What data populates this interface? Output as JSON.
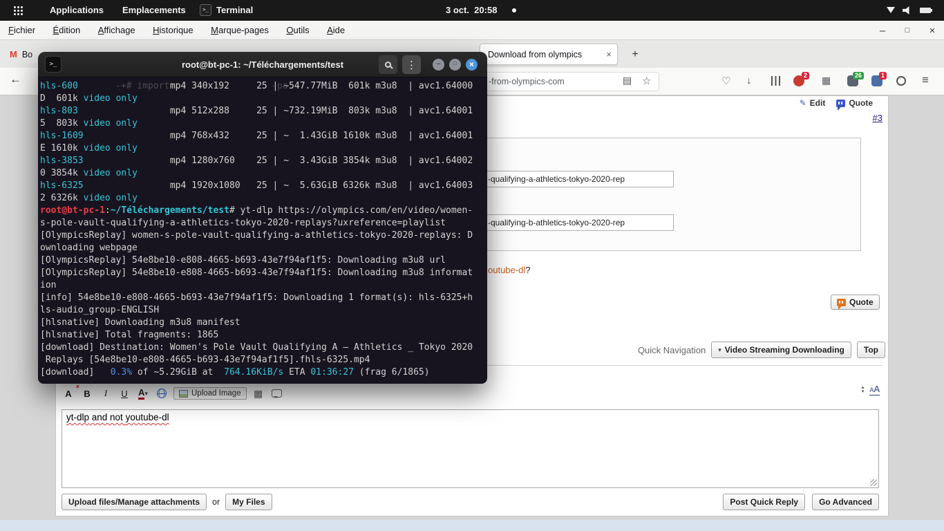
{
  "topbar": {
    "applications": "Applications",
    "places": "Emplacements",
    "terminal_item": "Terminal",
    "clock": "3 oct.  20:58"
  },
  "browser": {
    "menu": [
      "Fichier",
      "Édition",
      "Affichage",
      "Historique",
      "Marque-pages",
      "Outils",
      "Aide"
    ],
    "window_controls": {
      "minimize": "–",
      "maximize": "□",
      "close": "×"
    },
    "tabs": {
      "tab1_favicon": "M",
      "tab1_label": "Bo",
      "tab2_label": "Download from olympics",
      "tab2_close": "×",
      "new_tab": "+"
    },
    "nav": {
      "back": "←",
      "url_tail": "-from-olympics-com",
      "badges": {
        "adblock": "2",
        "scripts": "26",
        "alerts": "1"
      }
    }
  },
  "icons": {
    "caret": "▾",
    "kebab": "⋮",
    "star": "☆",
    "reader": "▤",
    "heart": "♡",
    "download": "↓",
    "grid": "▦",
    "hamburger": "≡",
    "film": "▦",
    "pencil": "✎",
    "arrow_up": "▴",
    "arrow_down": "▾",
    "small_x": "×",
    "terminal_glyph": ">_"
  },
  "terminal": {
    "title": "root@bt-pc-1: ~/Téléchargements/test",
    "ghost1": "-+# import",
    "ghost2": "-pa",
    "lines": [
      [
        {
          "t": "hls-600",
          "c": "cy"
        },
        {
          "t": "                 mp4 340x192     25 | ~547.77MiB  601k m3u8  | avc1.64000"
        }
      ],
      [
        {
          "t": "D  601k "
        },
        {
          "t": "video only",
          "c": "cy"
        }
      ],
      [
        {
          "t": "hls-803",
          "c": "cy"
        },
        {
          "t": "                 mp4 512x288     25 | ~732.19MiB  803k m3u8  | avc1.64001"
        }
      ],
      [
        {
          "t": "5  803k "
        },
        {
          "t": "video only",
          "c": "cy"
        }
      ],
      [
        {
          "t": "hls-1609",
          "c": "cy"
        },
        {
          "t": "                mp4 768x432     25 | ~  1.43GiB 1610k m3u8  | avc1.64001"
        }
      ],
      [
        {
          "t": "E 1610k "
        },
        {
          "t": "video only",
          "c": "cy"
        }
      ],
      [
        {
          "t": "hls-3853",
          "c": "cy"
        },
        {
          "t": "                mp4 1280x760    25 | ~  3.43GiB 3854k m3u8  | avc1.64002"
        }
      ],
      [
        {
          "t": "0 3854k "
        },
        {
          "t": "video only",
          "c": "cy"
        }
      ],
      [
        {
          "t": "hls-6325",
          "c": "cy"
        },
        {
          "t": "                mp4 1920x1080   25 | ~  5.63GiB 6326k m3u8  | avc1.64003"
        }
      ],
      [
        {
          "t": "2 6326k "
        },
        {
          "t": "video only",
          "c": "cy"
        }
      ],
      [
        {
          "t": "root@bt-pc-1",
          "c": "rd"
        },
        {
          "t": ":"
        },
        {
          "t": "~/Téléchargements/test",
          "c": "pt"
        },
        {
          "t": "# yt-dlp https://olympics.com/en/video/women-"
        }
      ],
      [
        {
          "t": "s-pole-vault-qualifying-a-athletics-tokyo-2020-replays?uxreference=playlist"
        }
      ],
      [
        {
          "t": "[OlympicsReplay] women-s-pole-vault-qualifying-a-athletics-tokyo-2020-replays: D"
        }
      ],
      [
        {
          "t": "ownloading webpage"
        }
      ],
      [
        {
          "t": "[OlympicsReplay] 54e8be10-e808-4665-b693-43e7f94af1f5: Downloading m3u8 url"
        }
      ],
      [
        {
          "t": "[OlympicsReplay] 54e8be10-e808-4665-b693-43e7f94af1f5: Downloading m3u8 informat"
        }
      ],
      [
        {
          "t": "ion"
        }
      ],
      [
        {
          "t": "[info] 54e8be10-e808-4665-b693-43e7f94af1f5: Downloading 1 format(s): hls-6325+h"
        }
      ],
      [
        {
          "t": "ls-audio_group-ENGLISH"
        }
      ],
      [
        {
          "t": "[hlsnative] Downloading m3u8 manifest"
        }
      ],
      [
        {
          "t": "[hlsnative] Total fragments: 1865"
        }
      ],
      [
        {
          "t": "[download] Destination: Women's Pole Vault Qualifying A – Athletics _ Tokyo 2020"
        }
      ],
      [
        {
          "t": " Replays [54e8be10-e808-4665-b693-43e7f94af1f5].fhls-6325.mp4"
        }
      ],
      [
        {
          "t": "[download]   "
        },
        {
          "t": "0.3%",
          "c": "bl"
        },
        {
          "t": " of ~5.29GiB at  "
        },
        {
          "t": "764.16KiB/s",
          "c": "cy"
        },
        {
          "t": " ETA "
        },
        {
          "t": "01:36:27",
          "c": "cy"
        },
        {
          "t": " (frag 6/1865)"
        }
      ]
    ]
  },
  "forum": {
    "edit_link": "Edit",
    "quote_link": "Quote",
    "post_number": "#3",
    "code_line1": "-qualifying-a-athletics-tokyo-2020-rep",
    "code_line2": "-qualifying-b-athletics-tokyo-2020-rep",
    "post_text_link": "outube-dl",
    "post_text_suffix": "?",
    "quote_button": "Quote",
    "quick_navigation_label": "Quick Navigation",
    "quick_nav_dropdown": "Video Streaming Downloading",
    "top_button": "Top",
    "editor": {
      "remove_format": "A",
      "bold": "B",
      "italic": "I",
      "underline": "U",
      "font_color": "A",
      "upload_image": "Upload Image",
      "size_small": "A",
      "size_large": "A",
      "reply_word1": "yt-dlp",
      "reply_word2": " and not ",
      "reply_word3": "youtube-dl"
    },
    "buttons": {
      "upload_files": "Upload files/Manage attachments",
      "or": "or",
      "my_files": "My Files",
      "post_quick_reply": "Post Quick Reply",
      "go_advanced": "Go Advanced"
    }
  },
  "colors": {
    "close_button_blue": "#4f94d8",
    "terminal_bg": "#17141f",
    "accent_cyan": "#35c5d8",
    "prompt_red": "#ef3b44",
    "link_orange": "#c4601d"
  }
}
